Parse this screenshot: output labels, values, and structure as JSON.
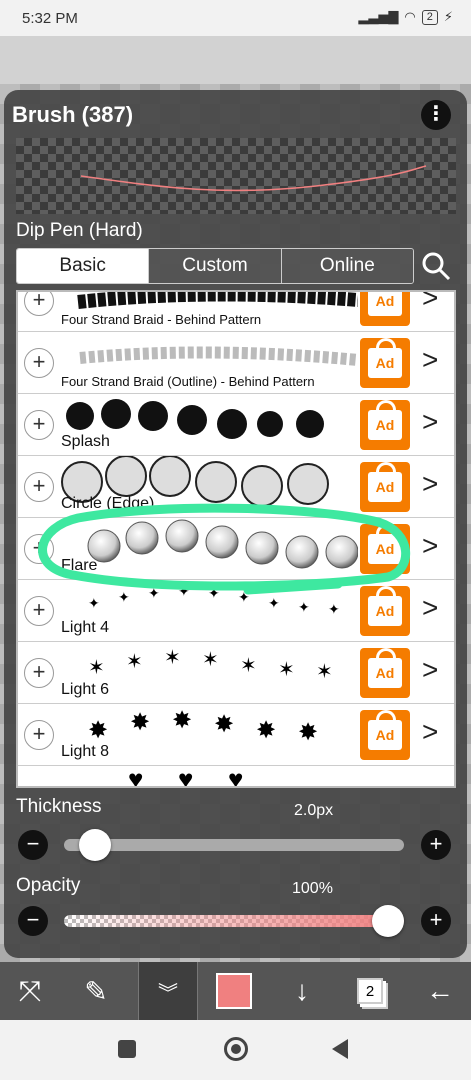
{
  "status_bar": {
    "time": "5:32 PM",
    "signal": "....ıl",
    "battery": "2"
  },
  "panel": {
    "title": "Brush (387)",
    "more_icon": "more-vertical-icon",
    "brush_name": "Dip Pen (Hard)"
  },
  "tabs": [
    {
      "label": "Basic",
      "active": true
    },
    {
      "label": "Custom",
      "active": false
    },
    {
      "label": "Online",
      "active": false
    }
  ],
  "brush_list": [
    {
      "label": "Four Strand Braid - Behind Pattern",
      "locked": true,
      "preview": "braid-black"
    },
    {
      "label": "Four Strand Braid (Outline) - Behind Pattern",
      "locked": true,
      "preview": "braid-outline"
    },
    {
      "label": "Splash",
      "locked": true,
      "preview": "splash"
    },
    {
      "label": "Circle (Edge)",
      "locked": true,
      "preview": "circle-edge"
    },
    {
      "label": "Flare",
      "locked": true,
      "preview": "flare"
    },
    {
      "label": "Light 4",
      "locked": true,
      "preview": "light4"
    },
    {
      "label": "Light 6",
      "locked": true,
      "preview": "light6"
    },
    {
      "label": "Light 8",
      "locked": true,
      "preview": "light8"
    }
  ],
  "ad_label": "Ad",
  "thickness": {
    "label": "Thickness",
    "value": "2.0px",
    "fraction": 0.05
  },
  "opacity": {
    "label": "Opacity",
    "value": "100%",
    "fraction": 1.0
  },
  "colors": {
    "accent_color": "#f08080",
    "ad_orange": "#f57c00",
    "highlight_green": "#3ee8a0"
  },
  "toolbar": {
    "items": [
      "transform-icon",
      "brush-icon",
      "collapse-icon",
      "color-swatch",
      "download-icon",
      "layers-icon",
      "back-arrow-icon"
    ],
    "layer_count": "2"
  }
}
